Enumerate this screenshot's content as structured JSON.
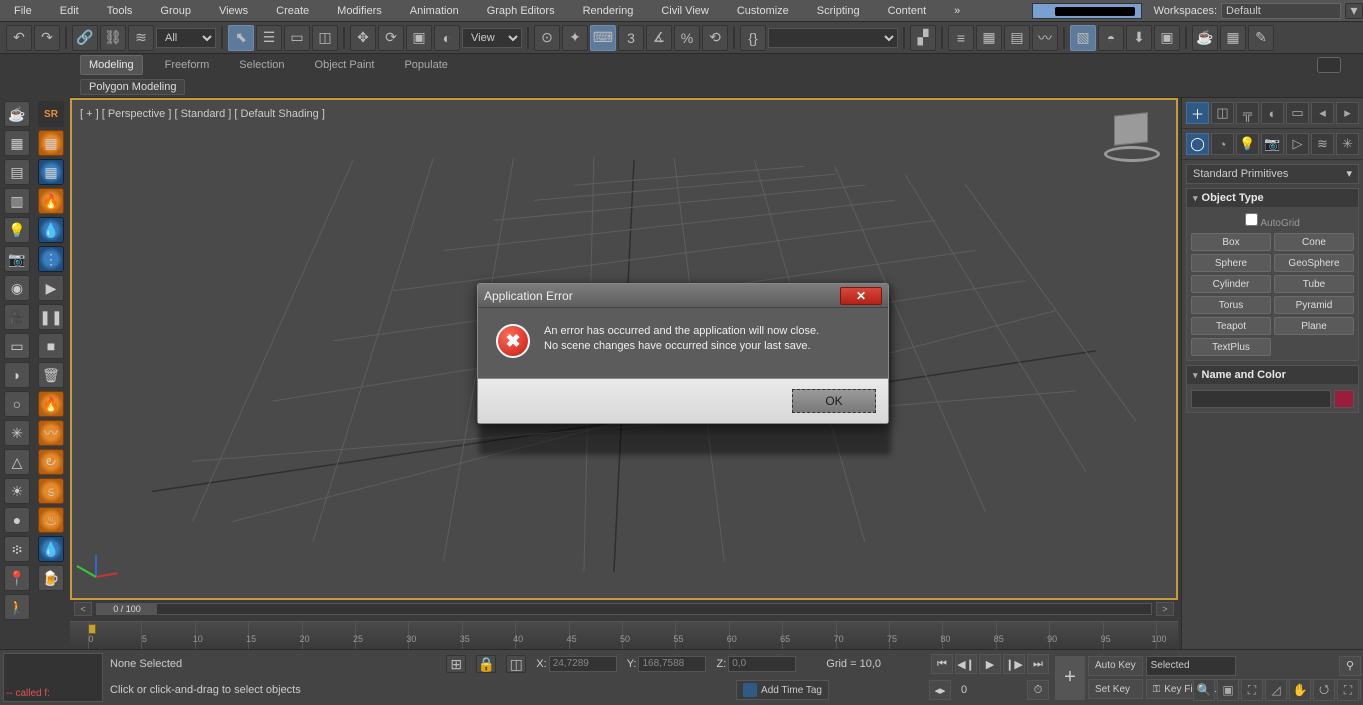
{
  "menu": {
    "items": [
      "File",
      "Edit",
      "Tools",
      "Group",
      "Views",
      "Create",
      "Modifiers",
      "Animation",
      "Graph Editors",
      "Rendering",
      "Civil View",
      "Customize",
      "Scripting",
      "Content"
    ],
    "workspace_label": "Workspaces:",
    "workspace_value": "Default"
  },
  "toolbar": {
    "filter": "All",
    "ref": "View"
  },
  "ribbon": {
    "tabs": [
      "Modeling",
      "Freeform",
      "Selection",
      "Object Paint",
      "Populate"
    ],
    "active": 0,
    "sub": "Polygon Modeling"
  },
  "viewport": {
    "label": "[ + ] [ Perspective ] [ Standard ] [ Default Shading ]"
  },
  "cmd": {
    "category": "Standard Primitives",
    "rollouts": {
      "object_type": "Object Type",
      "autogrid": "AutoGrid",
      "name_color": "Name and Color"
    },
    "buttons": [
      "Box",
      "Cone",
      "Sphere",
      "GeoSphere",
      "Cylinder",
      "Tube",
      "Torus",
      "Pyramid",
      "Teapot",
      "Plane",
      "TextPlus"
    ]
  },
  "timeline": {
    "scroll": "0 / 100",
    "ticks": [
      0,
      5,
      10,
      15,
      20,
      25,
      30,
      35,
      40,
      45,
      50,
      55,
      60,
      65,
      70,
      75,
      80,
      85,
      90,
      95,
      100
    ]
  },
  "status": {
    "script": "-- called f:",
    "sel": "None Selected",
    "hint": "Click or click-and-drag to select objects",
    "x_label": "X:",
    "x": "24,7289",
    "y_label": "Y:",
    "y": "168,7588",
    "z_label": "Z:",
    "z": "0,0",
    "grid": "Grid = 10,0",
    "frame": "0",
    "add_tag": "Add Time Tag",
    "autokey": "Auto Key",
    "setkey": "Set Key",
    "keymode": "Selected",
    "keyfilters": "Key Filters..."
  },
  "dialog": {
    "title": "Application Error",
    "line1": "An error has occurred and the application will now close.",
    "line2": "No scene changes have occurred since your last save.",
    "ok": "OK"
  },
  "left_tool_sr": "SR"
}
